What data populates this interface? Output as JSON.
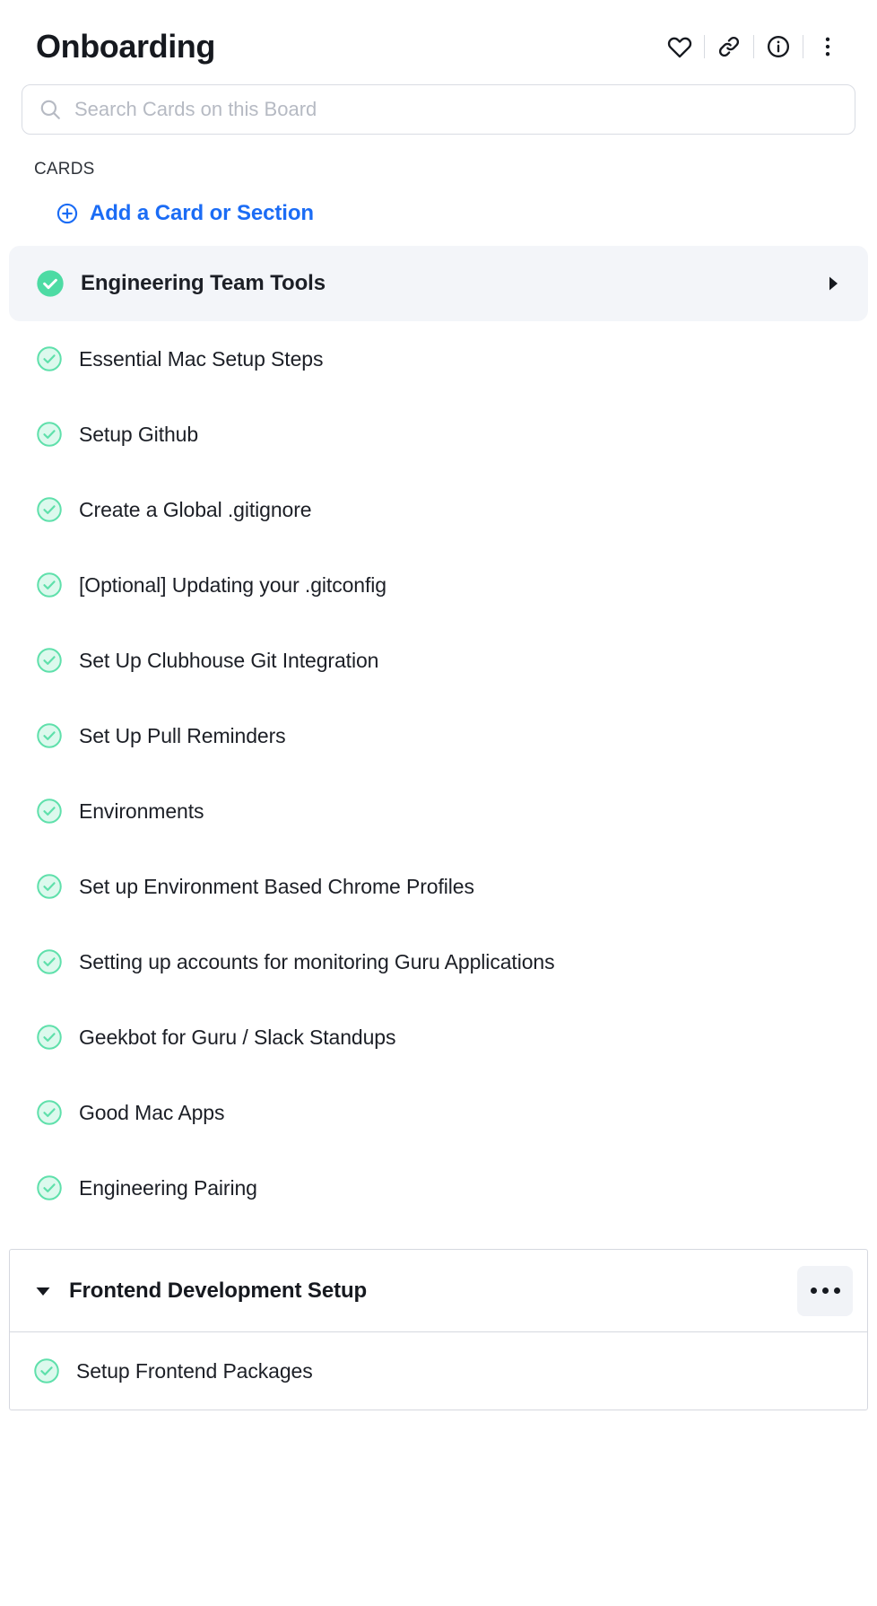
{
  "header": {
    "title": "Onboarding",
    "actions": [
      {
        "name": "favorite-icon",
        "label": "Favorite"
      },
      {
        "name": "link-icon",
        "label": "Copy Link"
      },
      {
        "name": "info-icon",
        "label": "Info"
      },
      {
        "name": "more-vertical-icon",
        "label": "More options"
      }
    ]
  },
  "search": {
    "placeholder": "Search Cards on this Board",
    "value": "",
    "icon": "search-icon"
  },
  "cards_section": {
    "label": "CARDS",
    "add_link": {
      "label": "Add a Card or Section",
      "icon": "plus-circle-icon"
    }
  },
  "cards": [
    {
      "label": "Engineering Team Tools",
      "active": true,
      "check": "check-circle-filled-icon",
      "caret": "caret-right-icon"
    },
    {
      "label": "Essential Mac Setup Steps",
      "active": false,
      "check": "check-circle-outline-icon"
    },
    {
      "label": "Setup Github",
      "active": false,
      "check": "check-circle-outline-icon"
    },
    {
      "label": "Create a Global .gitignore",
      "active": false,
      "check": "check-circle-outline-icon"
    },
    {
      "label": "[Optional] Updating your .gitconfig",
      "active": false,
      "check": "check-circle-outline-icon"
    },
    {
      "label": "Set Up Clubhouse Git Integration",
      "active": false,
      "check": "check-circle-outline-icon"
    },
    {
      "label": "Set Up Pull Reminders",
      "active": false,
      "check": "check-circle-outline-icon"
    },
    {
      "label": "Environments",
      "active": false,
      "check": "check-circle-outline-icon"
    },
    {
      "label": "Set up Environment Based Chrome Profiles",
      "active": false,
      "check": "check-circle-outline-icon"
    },
    {
      "label": "Setting up accounts for monitoring Guru Applications",
      "active": false,
      "check": "check-circle-outline-icon"
    },
    {
      "label": "Geekbot for Guru / Slack Standups",
      "active": false,
      "check": "check-circle-outline-icon"
    },
    {
      "label": "Good Mac Apps",
      "active": false,
      "check": "check-circle-outline-icon"
    },
    {
      "label": "Engineering Pairing",
      "active": false,
      "check": "check-circle-outline-icon"
    }
  ],
  "section": {
    "title": "Frontend Development Setup",
    "collapse_icon": "caret-down-icon",
    "more_icon": "more-horizontal-icon",
    "items": [
      {
        "label": "Setup Frontend Packages",
        "check": "check-circle-outline-icon"
      }
    ]
  },
  "colors": {
    "accent_blue": "#1b6cf5",
    "check_green": "#4ddba4",
    "check_green_light": "#d9f8ec",
    "active_row_bg": "#f3f5f9",
    "text_dark": "#16191f",
    "border": "#d5d8df"
  }
}
